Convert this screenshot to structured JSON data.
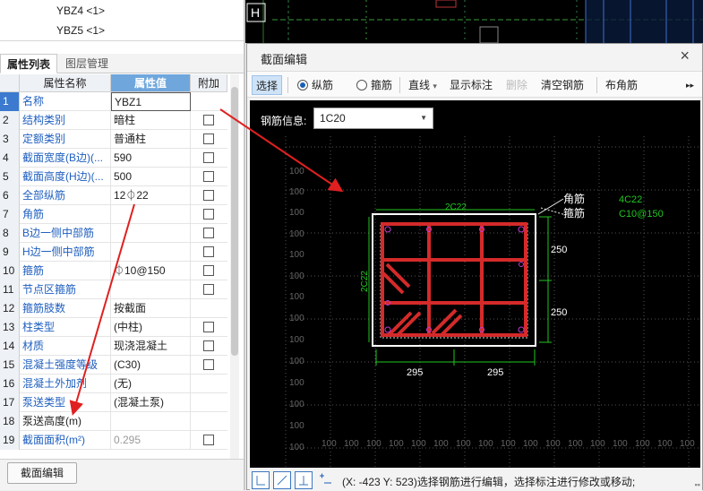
{
  "tree": {
    "items": [
      "YBZ4 <1>",
      "YBZ5 <1>"
    ]
  },
  "tabs": {
    "active": "属性列表",
    "inactive": "图层管理"
  },
  "grid": {
    "headers": {
      "name": "属性名称",
      "value": "属性值",
      "extra": "附加"
    },
    "rows": [
      {
        "num": "1",
        "name": "名称",
        "value": "YBZ1",
        "check": false
      },
      {
        "num": "2",
        "name": "结构类别",
        "value": "暗柱",
        "check": true
      },
      {
        "num": "3",
        "name": "定额类别",
        "value": "普通柱",
        "check": true
      },
      {
        "num": "4",
        "name": "截面宽度(B边)(...",
        "value": "590",
        "check": true
      },
      {
        "num": "5",
        "name": "截面高度(H边)(...",
        "value": "500",
        "check": true
      },
      {
        "num": "6",
        "name": "全部纵筋",
        "value": "12⏀22",
        "check": true
      },
      {
        "num": "7",
        "name": "角筋",
        "value": "",
        "check": true
      },
      {
        "num": "8",
        "name": "B边一侧中部筋",
        "value": "",
        "check": true
      },
      {
        "num": "9",
        "name": "H边一侧中部筋",
        "value": "",
        "check": true
      },
      {
        "num": "10",
        "name": "箍筋",
        "value": "⏀10@150",
        "check": true
      },
      {
        "num": "11",
        "name": "节点区箍筋",
        "value": "",
        "check": true
      },
      {
        "num": "12",
        "name": "箍筋肢数",
        "value": "按截面",
        "check": false
      },
      {
        "num": "13",
        "name": "柱类型",
        "value": "(中柱)",
        "check": true
      },
      {
        "num": "14",
        "name": "材质",
        "value": "现浇混凝土",
        "check": true
      },
      {
        "num": "15",
        "name": "混凝土强度等级",
        "value": "(C30)",
        "check": true
      },
      {
        "num": "16",
        "name": "混凝土外加剂",
        "value": "(无)",
        "check": false
      },
      {
        "num": "17",
        "name": "泵送类型",
        "value": "(混凝土泵)",
        "check": false
      },
      {
        "num": "18",
        "name": "泵送高度(m)",
        "value": "",
        "check": false
      },
      {
        "num": "19",
        "name": "截面面积(m²)",
        "value": "0.295",
        "check": true
      }
    ]
  },
  "bottom": {
    "section_edit": "截面编辑"
  },
  "dialog": {
    "title": "截面编辑",
    "close": "×",
    "toolbar": {
      "select": "选择",
      "longitudinal": "纵筋",
      "stirrup": "箍筋",
      "line": "直线",
      "line_arrow": "▾",
      "show_dim": "显示标注",
      "delete": "删除",
      "clear": "清空钢筋",
      "corner": "布角筋",
      "more": "▸▸"
    },
    "rebar_label": "钢筋信息:",
    "rebar_value": "1C20",
    "rebar_arrow": "▼",
    "canvas": {
      "label_corner": "角筋",
      "label_stirrup": "箍筋",
      "spec_corner": "4C22",
      "spec_stirrup": "C10@150",
      "top_bars": "2C22",
      "side_bars": "2C22",
      "dim_h1": "250",
      "dim_h2": "250",
      "dim_b1": "295",
      "dim_b2": "295",
      "grid_value": "100"
    },
    "status": "(X: -423 Y: 523)选择钢筋进行编辑，选择标注进行修改或移动;"
  },
  "colors": {
    "rebar": "#e02020",
    "stirrup": "#d42a2a",
    "dim": "#22c522",
    "annot_arrow": "#e02020",
    "selected_tab": "#6fa7dd"
  }
}
